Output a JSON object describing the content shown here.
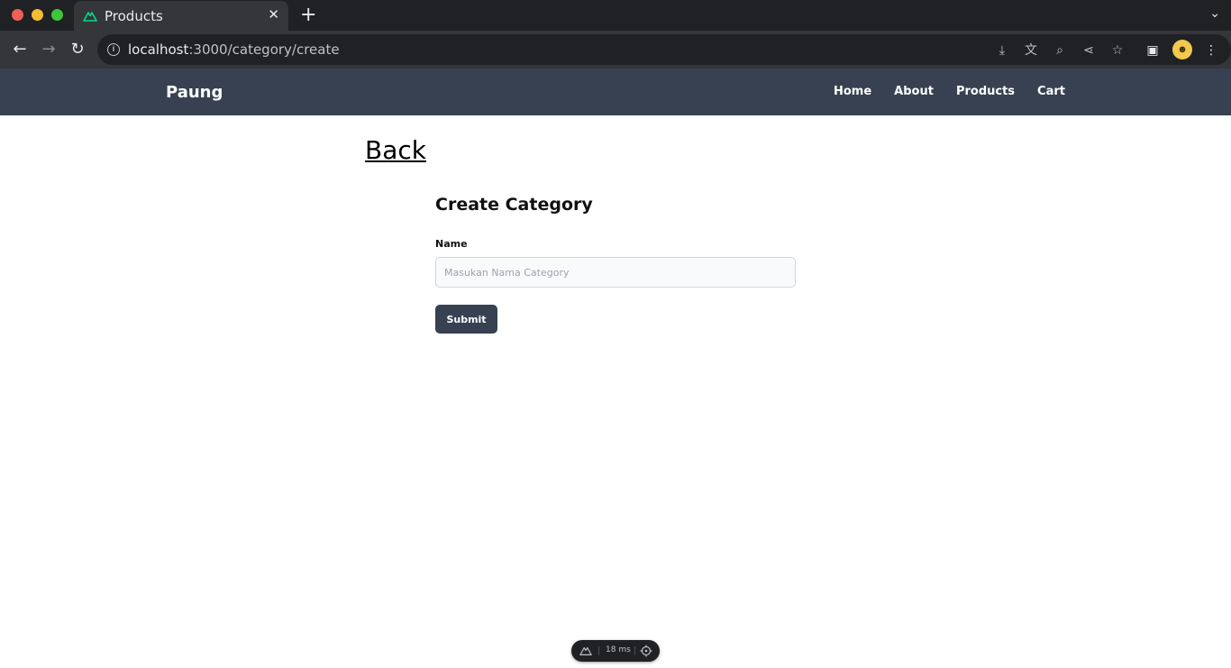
{
  "browser": {
    "tab_title": "Products",
    "url_host": "localhost",
    "url_path": ":3000/category/create",
    "icons": [
      "back-arrow-icon",
      "forward-arrow-icon",
      "reload-icon",
      "info-icon",
      "install-icon",
      "translate-icon",
      "zoom-icon",
      "share-icon",
      "star-icon",
      "side-panel-icon",
      "profile-icon",
      "menu-icon"
    ],
    "colors": {
      "tabstrip": "#202124",
      "toolbar": "#35363a"
    }
  },
  "navbar": {
    "brand": "Paung",
    "links": [
      "Home",
      "About",
      "Products",
      "Cart"
    ],
    "color": "#374151"
  },
  "page": {
    "back_label": "Back",
    "form_title": "Create Category",
    "name_label": "Name",
    "name_placeholder": "Masukan Nama Category",
    "name_value": "",
    "submit_label": "Submit"
  },
  "devtools": {
    "time_label": "18 ms"
  }
}
